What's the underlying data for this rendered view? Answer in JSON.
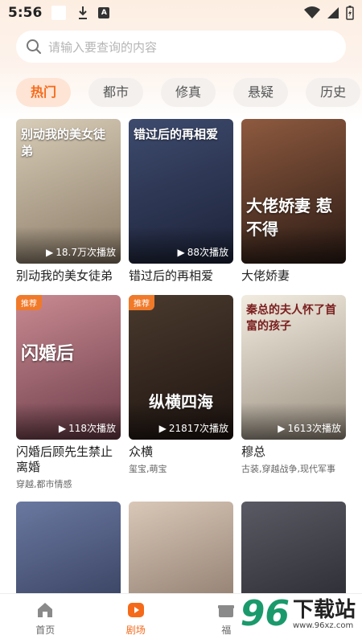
{
  "status_bar": {
    "time": "5:56",
    "a_icon": "A"
  },
  "search": {
    "placeholder": "请输入要查询的内容"
  },
  "categories": [
    {
      "label": "热门",
      "active": true
    },
    {
      "label": "都市",
      "active": false
    },
    {
      "label": "修真",
      "active": false
    },
    {
      "label": "悬疑",
      "active": false
    },
    {
      "label": "历史",
      "active": false
    }
  ],
  "dramas": [
    {
      "title": "别动我的美女徒弟",
      "plays": "18.7万次播放",
      "badge": "",
      "tags": "",
      "poster_text": "别动我的美女徒弟",
      "colors": [
        "#d8cdb8",
        "#8a7a66"
      ]
    },
    {
      "title": "错过后的再相爱",
      "plays": "88次播放",
      "badge": "",
      "tags": "",
      "poster_text": "错过后的再相爱",
      "colors": [
        "#3e4b6e",
        "#1c2238"
      ]
    },
    {
      "title": "大佬娇妻",
      "plays": "",
      "badge": "",
      "tags": "",
      "poster_text": "大佬娇妻 惹不得",
      "colors": [
        "#8e5a3f",
        "#2a1a14"
      ]
    },
    {
      "title": "闪婚后顾先生禁止离婚",
      "plays": "118次播放",
      "badge": "推荐",
      "tags": "穿越,都市情感",
      "poster_text": "闪婚后",
      "colors": [
        "#c98a92",
        "#6b3c48"
      ]
    },
    {
      "title": "众横",
      "plays": "21817次播放",
      "badge": "推荐",
      "tags": "玺宝,萌宝",
      "poster_text": "纵横四海",
      "colors": [
        "#4a3a2e",
        "#1e1410"
      ]
    },
    {
      "title": "穆总",
      "plays": "1613次播放",
      "badge": "",
      "tags": "古装,穿越战争,现代军事",
      "poster_text": "秦总的夫人怀了首富的孩子",
      "colors": [
        "#f2ece0",
        "#9a8f80"
      ]
    },
    {
      "title": "",
      "plays": "",
      "badge": "",
      "tags": "",
      "poster_text": "",
      "colors": [
        "#6a78a0",
        "#2b3350"
      ]
    },
    {
      "title": "",
      "plays": "",
      "badge": "",
      "tags": "",
      "poster_text": "",
      "colors": [
        "#d9c7b8",
        "#7d6a5c"
      ]
    },
    {
      "title": "",
      "plays": "",
      "badge": "",
      "tags": "",
      "poster_text": "",
      "colors": [
        "#5a5a64",
        "#1f1f26"
      ]
    }
  ],
  "bottom_nav": [
    {
      "label": "首页",
      "icon": "home-icon",
      "active": false
    },
    {
      "label": "剧场",
      "icon": "play-icon",
      "active": true
    },
    {
      "label": "福",
      "icon": "gift-icon",
      "active": false
    }
  ],
  "watermark": {
    "number": "96",
    "text": "下载站",
    "url": "www.96xz.com"
  },
  "accent_color": "#f56a1a"
}
